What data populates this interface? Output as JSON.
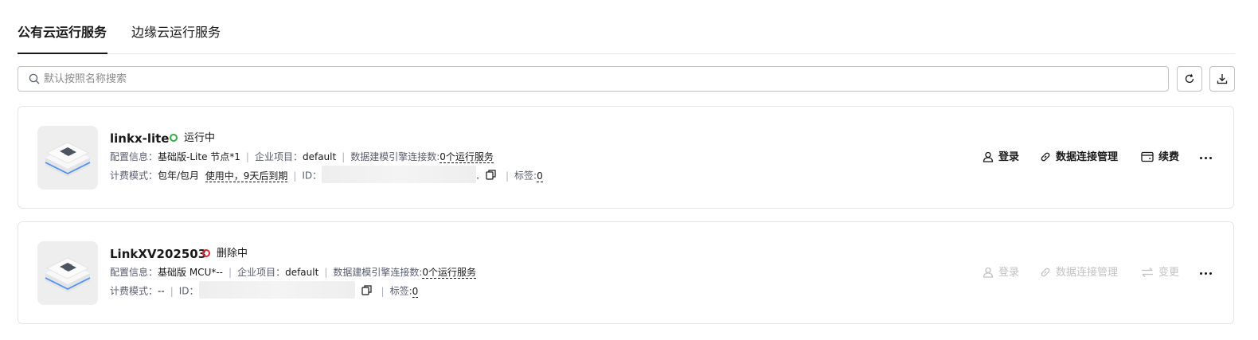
{
  "tabs": [
    {
      "label": "公有云运行服务",
      "active": true
    },
    {
      "label": "边缘云运行服务",
      "active": false
    }
  ],
  "search": {
    "placeholder": "默认按照名称搜索"
  },
  "toolbar": {
    "refresh_icon": "refresh-icon",
    "download_icon": "download-icon"
  },
  "instances": [
    {
      "name": "linkx-lite",
      "status": "运行中",
      "status_color": "#2eaf3e",
      "config_label": "配置信息：",
      "config_value": "基础版-Lite 节点*1",
      "project_label": "企业项目：",
      "project_value": "default",
      "engine_label": "数据建模引擎连接数:",
      "engine_value": "0个运行服务",
      "billing_label": "计费模式：",
      "billing_value": "包年/包月",
      "billing_status": "使用中，9天后到期",
      "id_label": "ID：",
      "id_suffix": ".",
      "tags_label": "标签:",
      "tags_value": "0",
      "actions": [
        {
          "label": "登录",
          "icon": "user-icon",
          "enabled": true
        },
        {
          "label": "数据连接管理",
          "icon": "link-icon",
          "enabled": true
        },
        {
          "label": "续费",
          "icon": "wallet-icon",
          "enabled": true
        }
      ]
    },
    {
      "name": "LinkXV202503",
      "status": "删除中",
      "status_color": "#e0262e",
      "config_label": "配置信息：",
      "config_value": "基础版 MCU*--",
      "project_label": "企业项目：",
      "project_value": "default",
      "engine_label": "数据建模引擎连接数:",
      "engine_value": "0个运行服务",
      "billing_label": "计费模式：",
      "billing_value": "--",
      "id_label": "ID：",
      "tags_label": "标签:",
      "tags_value": "0",
      "actions": [
        {
          "label": "登录",
          "icon": "user-icon",
          "enabled": false
        },
        {
          "label": "数据连接管理",
          "icon": "link-icon",
          "enabled": false
        },
        {
          "label": "变更",
          "icon": "swap-icon",
          "enabled": false
        }
      ]
    }
  ]
}
